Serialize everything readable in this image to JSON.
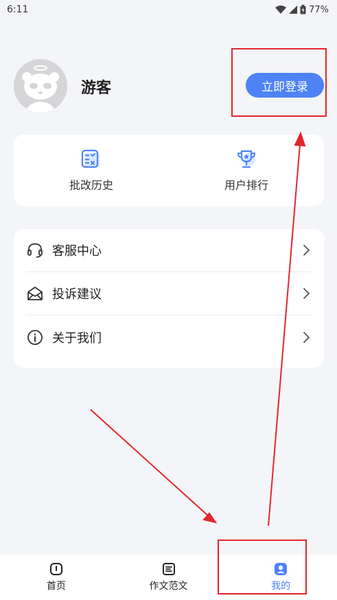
{
  "status_bar": {
    "time": "6:11",
    "battery": "77%"
  },
  "profile": {
    "username": "游客",
    "login_button": "立即登录"
  },
  "features": [
    {
      "label": "批改历史",
      "icon": "grading-history-icon"
    },
    {
      "label": "用户排行",
      "icon": "trophy-icon"
    }
  ],
  "menu": [
    {
      "label": "客服中心",
      "icon": "headset-icon"
    },
    {
      "label": "投诉建议",
      "icon": "envelope-icon"
    },
    {
      "label": "关于我们",
      "icon": "info-icon"
    }
  ],
  "bottom_nav": [
    {
      "label": "首页",
      "icon": "home-icon"
    },
    {
      "label": "作文范文",
      "icon": "document-icon"
    },
    {
      "label": "我的",
      "icon": "user-icon",
      "active": true
    }
  ],
  "colors": {
    "accent": "#4d83f5",
    "annotation": "#e0262c"
  }
}
